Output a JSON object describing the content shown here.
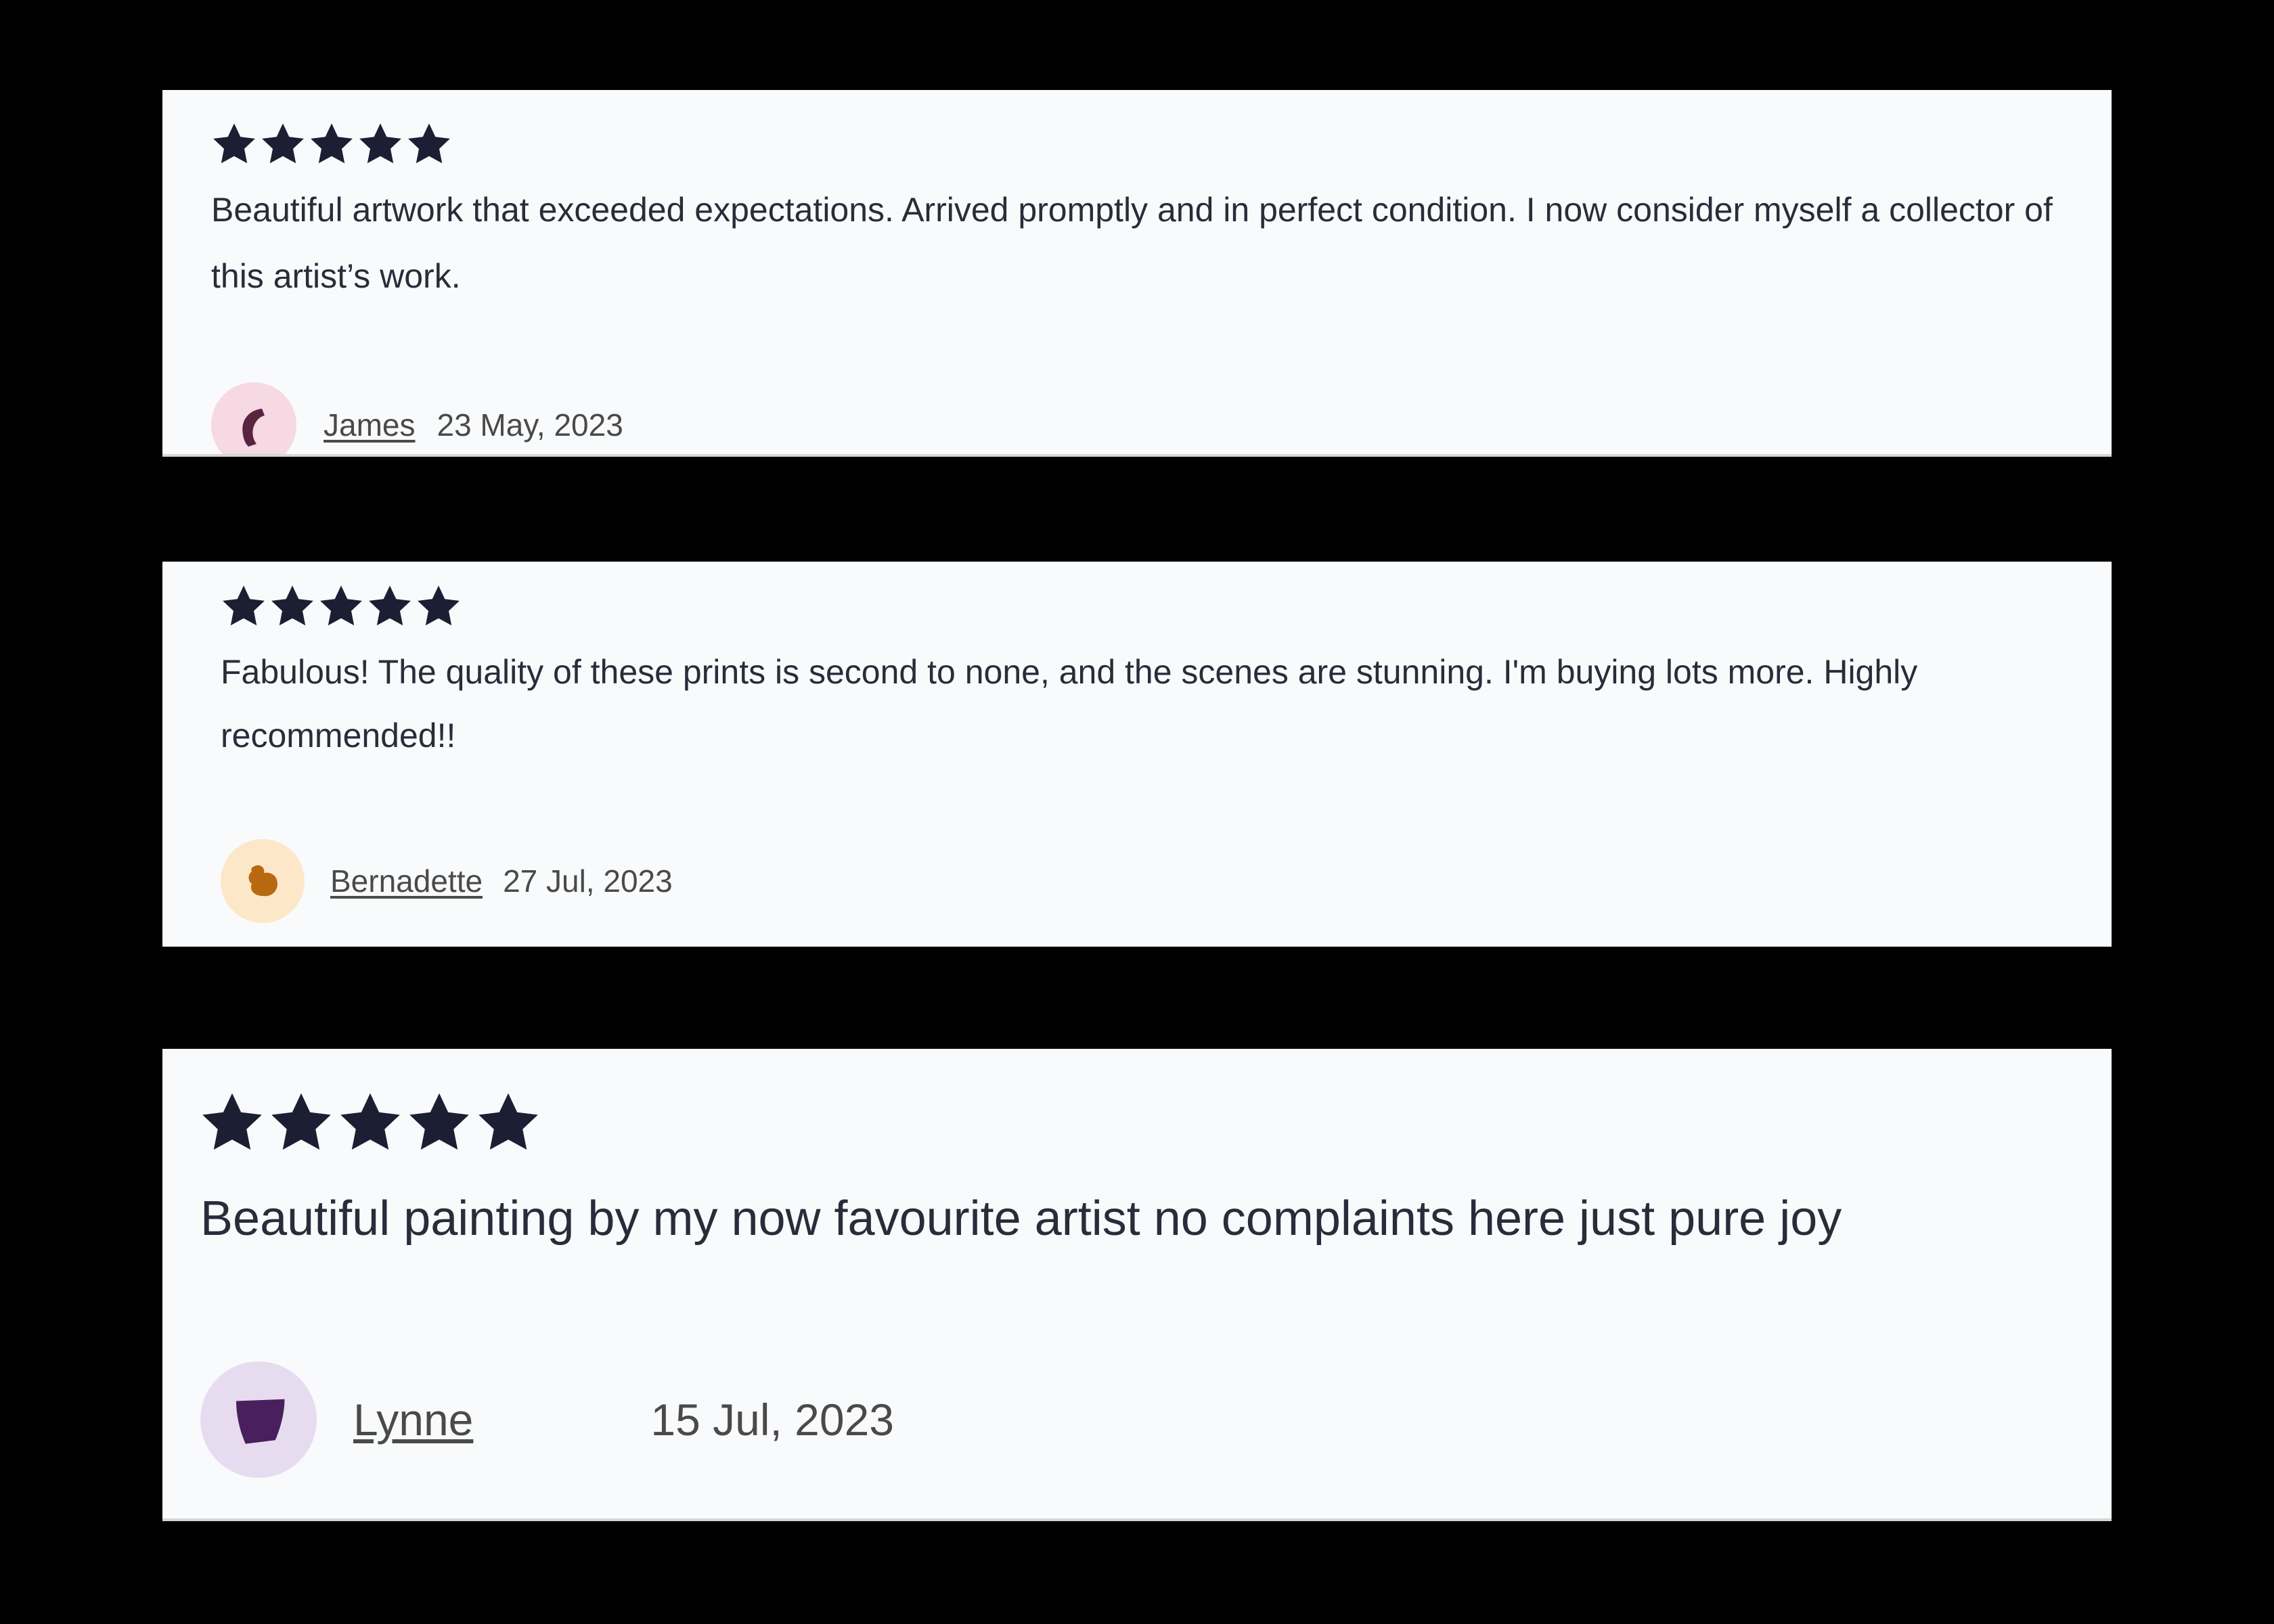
{
  "reviews": [
    {
      "rating": 5,
      "text": "Beautiful artwork that exceeded expectations. Arrived promptly and in perfect condition. I now consider myself a collector of this artist’s work.",
      "reviewer": "James",
      "date": "23 May, 2023",
      "avatar_icon": "abstract-crescent-shape-icon",
      "avatar_bg": "#f6d9e2",
      "avatar_fg": "#5a2340"
    },
    {
      "rating": 5,
      "text": "Fabulous! The quality of these prints is second to none, and the scenes are stunning. I'm buying lots more. Highly recommended!!",
      "reviewer": "Bernadette",
      "date": "27 Jul, 2023",
      "avatar_icon": "abstract-blob-shape-icon",
      "avatar_bg": "#fde7c9",
      "avatar_fg": "#b8680f"
    },
    {
      "rating": 5,
      "text": "Beautiful painting by my now favourite artist no complaints here just pure joy",
      "reviewer": "Lynne",
      "date": "15 Jul, 2023",
      "avatar_icon": "abstract-trapezoid-shape-icon",
      "avatar_bg": "#e7dcef",
      "avatar_fg": "#4a1f5e"
    }
  ],
  "colors": {
    "background": "#000000",
    "card": "#f9fafb",
    "star": "#1c1f33",
    "text": "#2b2b3a",
    "meta_text": "#4a4a4a"
  }
}
